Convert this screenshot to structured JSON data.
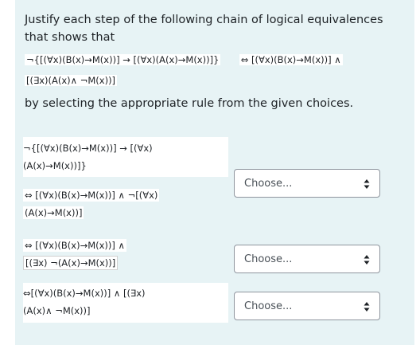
{
  "question": {
    "intro": "Justify each step of the following chain of logical equivalences that shows that",
    "statement_line1": "¬{[(∀x)(B(x)→M(x))] → [(∀x)(A(x)→M(x))]}",
    "statement_equiv": "⇔ [(∀x)(B(x)→M(x))] ∧",
    "statement_line2": "[(∃x)(A(x)∧ ¬M(x))]",
    "instruction": "by selecting the appropriate rule from the given choices."
  },
  "steps": [
    {
      "line1": "¬{[(∀x)(B(x)→M(x))] → [(∀x)",
      "line2": "(A(x)→M(x))]}",
      "select_value": "Choose..."
    },
    {
      "line1": "⇔ [(∀x)(B(x)→M(x))] ∧ ¬[(∀x)",
      "line2": "(A(x)→M(x))]",
      "select_value": "Choose..."
    },
    {
      "line1": "⇔ [(∀x)(B(x)→M(x))] ∧",
      "line2": "[(∃x) ¬(A(x)→M(x))]",
      "select_value": "Choose..."
    },
    {
      "line1": "⇔[(∀x)(B(x)→M(x))] ∧ [(∃x)",
      "line2": "(A(x)∧ ¬M(x))]",
      "select_value": ""
    }
  ],
  "colors": {
    "panel_bg": "#e7f3f5",
    "text": "#1d2125",
    "select_border": "#8f959e"
  }
}
